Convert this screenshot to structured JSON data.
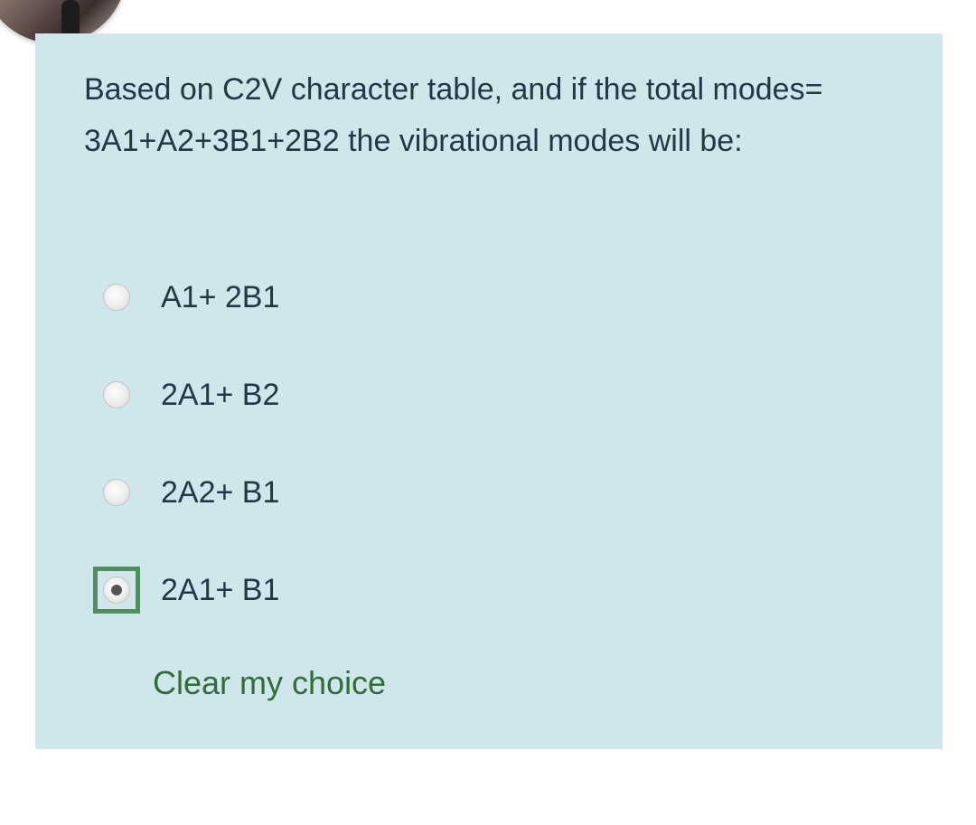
{
  "avatar": {
    "icon": "profile-photo"
  },
  "question": {
    "text": "Based on C2V character table, and if the total modes= 3A1+A2+3B1+2B2 the vibrational modes will be:"
  },
  "answers": [
    {
      "label": "A1+ 2B1",
      "selected": false
    },
    {
      "label": "2A1+ B2",
      "selected": false
    },
    {
      "label": "2A2+ B1",
      "selected": false
    },
    {
      "label": "2A1+ B1",
      "selected": true
    }
  ],
  "clear_choice": {
    "label": "Clear my choice"
  },
  "colors": {
    "card_background": "#cfe6eb",
    "text": "#1f3a46",
    "link": "#2f6e35",
    "focus_ring": "#4f8f5f"
  }
}
